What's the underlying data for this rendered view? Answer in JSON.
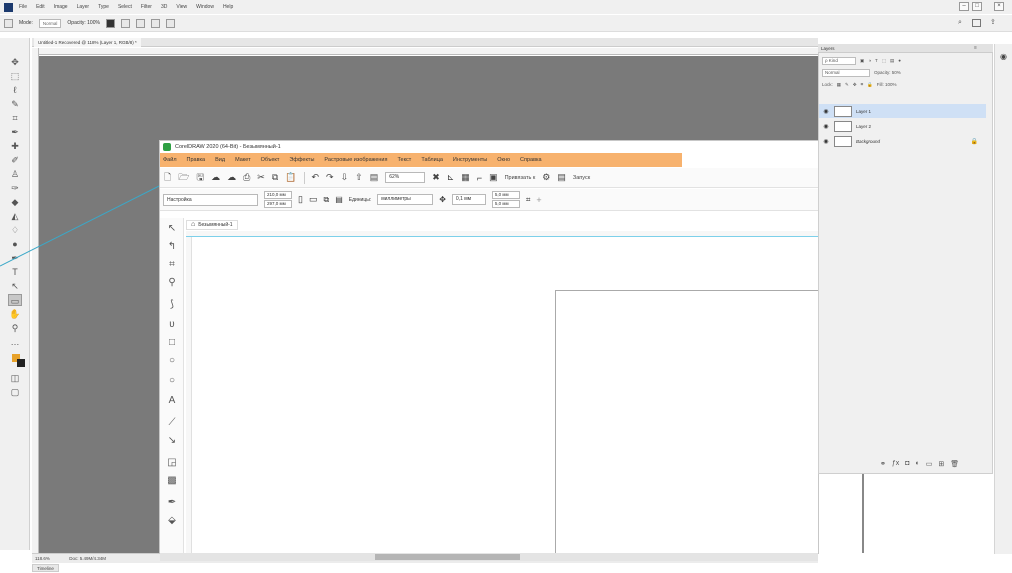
{
  "photoshop": {
    "menu": [
      "File",
      "Edit",
      "Image",
      "Layer",
      "Type",
      "Select",
      "Filter",
      "3D",
      "View",
      "Window",
      "Help"
    ],
    "options": {
      "mode_label": "Mode:",
      "mode_value": "Normal",
      "opacity_label": "Opacity: 100%"
    },
    "doc_tab": "Untitled-1 Recovered @ 118% (Layer 1, RGB/8) *",
    "status_zoom": "118.6%",
    "status_doc": "Doc: 5.49M/4.34M",
    "timeline": "Timeline",
    "window_controls": [
      "–",
      "□",
      "×"
    ],
    "right_icons": [
      "search-icon",
      "workspace-icon",
      "share-icon"
    ]
  },
  "layers_panel": {
    "tab": "Layers",
    "kind": "ρ Kind",
    "blend": "Normal",
    "opacity": "Opacity: 50%",
    "lock_label": "Lock:",
    "fill": "Fill: 100%",
    "layers": [
      {
        "name": "Layer 1",
        "selected": true
      },
      {
        "name": "Layer 2",
        "selected": false
      },
      {
        "name": "Background",
        "selected": false,
        "locked": true
      }
    ]
  },
  "corel": {
    "title": "CorelDRAW 2020 (64-Bit) - Безымянный-1",
    "menu": [
      "Файл",
      "Правка",
      "Вид",
      "Макет",
      "Объект",
      "Эффекты",
      "Растровые изображения",
      "Текст",
      "Таблица",
      "Инструменты",
      "Окно",
      "Справка"
    ],
    "zoom": "62%",
    "snap": "Привязать к",
    "launch": "Запуск",
    "preset": "Настройка",
    "width": "210,0 мм",
    "height": "297,0 мм",
    "units_label": "Единицы:",
    "units_value": "миллиметры",
    "nudge": "0,1 мм",
    "dup_x": "5,0 мм",
    "dup_y": "5,0 мм",
    "doc_tab": "Безымянный-1"
  },
  "colors": {
    "corel_menu_highlight": "#f7b26e",
    "ps_canvas": "#7a7a7a",
    "foreground_swatch": "#e8a22a",
    "selected_layer": "#cfe0f5",
    "annotation_line": "#3aa8c8"
  }
}
